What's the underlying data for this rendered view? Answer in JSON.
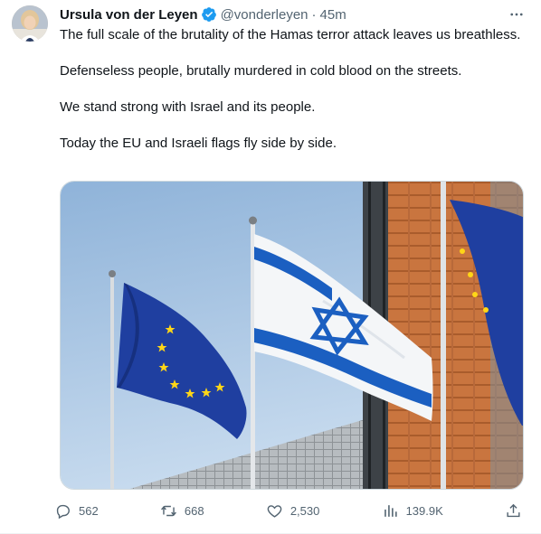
{
  "author": {
    "name": "Ursula von der Leyen",
    "handle": "@vonderleyen",
    "separator": "·",
    "time": "45m"
  },
  "tweet": {
    "paragraphs": [
      "The full scale of the brutality of the Hamas terror attack leaves us breathless.",
      "Defenseless people, brutally murdered in cold blood on the streets.",
      "We stand strong with Israel and its people.",
      "Today the EU and Israeli flags fly side by side."
    ]
  },
  "actions": {
    "replies": "562",
    "retweets": "668",
    "likes": "2,530",
    "views": "139.9K"
  },
  "icons": {
    "verified": "verified-badge-icon",
    "more": "more-options-icon",
    "reply": "reply-icon",
    "retweet": "retweet-icon",
    "like": "heart-icon",
    "views": "views-chart-icon",
    "share": "share-icon"
  },
  "colors": {
    "verified_blue": "#1d9bf0",
    "text_primary": "#0f1419",
    "text_secondary": "#536471",
    "eu_blue": "#1f3fa0",
    "eu_star": "#ffd617",
    "israel_blue": "#1b5fc1"
  }
}
